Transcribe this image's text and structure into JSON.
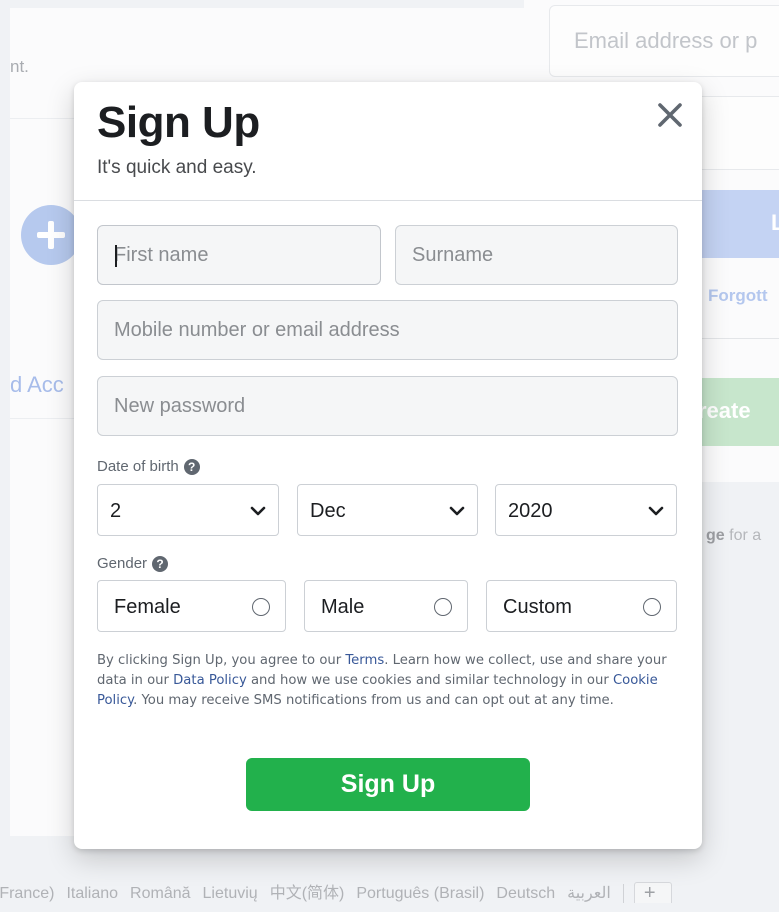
{
  "background": {
    "left_hint": "nt.",
    "left_link": "d Acc",
    "email_placeholder": "Email address or p",
    "login_label": "L",
    "forgot_link": "Forgott",
    "create_button": "reate",
    "page_text_bold": "ge",
    "page_text_rest": " for a",
    "footer_languages": [
      "(France)",
      "Italiano",
      "Română",
      "Lietuvių",
      "中文(简体)",
      "Português (Brasil)",
      "Deutsch",
      "العربية"
    ],
    "footer_more": "+"
  },
  "modal": {
    "title": "Sign Up",
    "subtitle": "It's quick and easy.",
    "close_label": "close",
    "fields": {
      "first_name_placeholder": "First name",
      "surname_placeholder": "Surname",
      "mobile_placeholder": "Mobile number or email address",
      "password_placeholder": "New password"
    },
    "dob": {
      "label": "Date of birth",
      "day": "2",
      "month": "Dec",
      "year": "2020"
    },
    "gender": {
      "label": "Gender",
      "options": [
        "Female",
        "Male",
        "Custom"
      ]
    },
    "help_glyph": "?",
    "terms": {
      "part1": "By clicking Sign Up, you agree to our ",
      "terms_link": "Terms",
      "part2": ". Learn how we collect, use and share your data in our ",
      "data_policy_link": "Data Policy",
      "part3": " and how we use cookies and similar technology in our ",
      "cookie_policy_link": "Cookie Policy",
      "part4": ". You may receive SMS notifications from us and can opt out at any time."
    },
    "submit_label": "Sign Up"
  },
  "colors": {
    "submit_green": "#22b14c",
    "link_blue": "#385898",
    "input_bg": "#f5f6f7"
  },
  "icons": {
    "close": "close-icon",
    "help": "help-circle-icon",
    "chevron": "chevron-down-icon",
    "add": "plus-icon",
    "radio": "radio-icon"
  }
}
